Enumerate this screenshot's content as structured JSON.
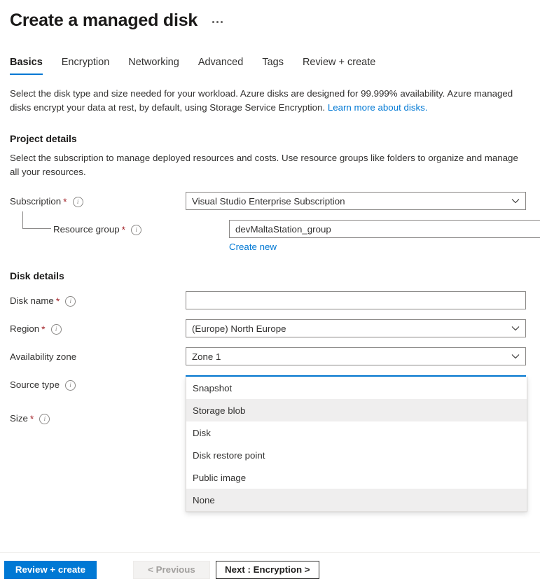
{
  "header": {
    "title": "Create a managed disk",
    "more_menu": "…"
  },
  "tabs": [
    {
      "label": "Basics",
      "active": true
    },
    {
      "label": "Encryption",
      "active": false
    },
    {
      "label": "Networking",
      "active": false
    },
    {
      "label": "Advanced",
      "active": false
    },
    {
      "label": "Tags",
      "active": false
    },
    {
      "label": "Review + create",
      "active": false
    }
  ],
  "intro": {
    "text_before_link": "Select the disk type and size needed for your workload. Azure disks are designed for 99.999% availability. Azure managed disks encrypt your data at rest, by default, using Storage Service Encryption. ",
    "link_label": "Learn more about disks."
  },
  "project_details": {
    "section_title": "Project details",
    "description": "Select the subscription to manage deployed resources and costs. Use resource groups like folders to organize and manage all your resources.",
    "subscription": {
      "label": "Subscription",
      "required": "*",
      "value": "Visual Studio Enterprise Subscription"
    },
    "resource_group": {
      "label": "Resource group",
      "required": "*",
      "value": "devMaltaStation_group",
      "create_new_label": "Create new"
    }
  },
  "disk_details": {
    "section_title": "Disk details",
    "disk_name": {
      "label": "Disk name",
      "required": "*",
      "value": "",
      "placeholder": ""
    },
    "region": {
      "label": "Region",
      "required": "*",
      "value": "(Europe) North Europe"
    },
    "availability_zone": {
      "label": "Availability zone",
      "required": "",
      "value": "Zone 1"
    },
    "source_type": {
      "label": "Source type",
      "required": "",
      "value": "None",
      "expanded": true,
      "options": [
        {
          "label": "Snapshot",
          "highlighted": false
        },
        {
          "label": "Storage blob",
          "highlighted": true
        },
        {
          "label": "Disk",
          "highlighted": false
        },
        {
          "label": "Disk restore point",
          "highlighted": false
        },
        {
          "label": "Public image",
          "highlighted": false
        },
        {
          "label": "None",
          "highlighted": true
        }
      ]
    },
    "size": {
      "label": "Size",
      "required": "*"
    }
  },
  "footer": {
    "review_create_label": "Review + create",
    "previous_label": "< Previous",
    "next_label": "Next : Encryption >"
  },
  "colors": {
    "accent": "#0078d4",
    "required_asterisk": "#a4262c",
    "text": "#323130",
    "border": "#8a8886",
    "option_highlight": "#efeeee"
  }
}
